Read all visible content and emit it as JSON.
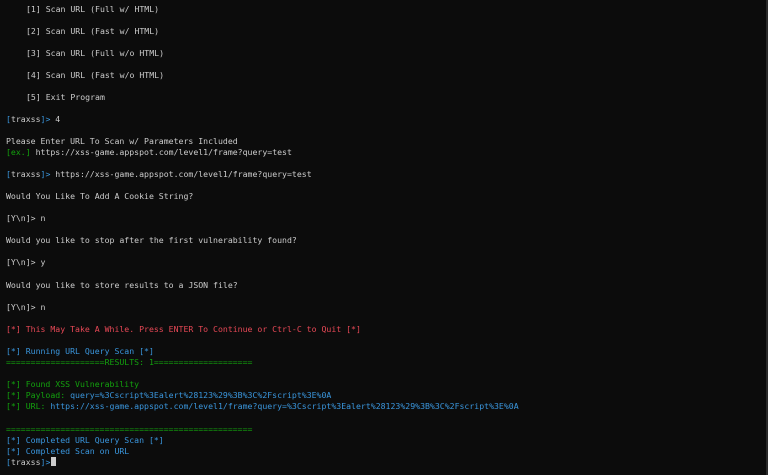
{
  "menu": {
    "opt1": "[1] Scan URL (Full w/ HTML)",
    "opt2": "[2] Scan URL (Fast w/ HTML)",
    "opt3": "[3] Scan URL (Full w/o HTML)",
    "opt4": "[4] Scan URL (Fast w/o HTML)",
    "opt5": "[5] Exit Program"
  },
  "prompt": {
    "open": "[",
    "name": "traxss",
    "close": "]>",
    "yn": "[Y\\n]>"
  },
  "session": {
    "choice": " 4",
    "enter_url": "Please Enter URL To Scan w/ Parameters Included",
    "example_tag": "[ex.]",
    "example_url": " https://xss-game.appspot.com/level1/frame?query=test",
    "url_input": " https://xss-game.appspot.com/level1/frame?query=test",
    "cookie_q": "Would You Like To Add A Cookie String?",
    "cookie_a": " n",
    "stop_q": "Would you like to stop after the first vulnerability found?",
    "stop_a": " y",
    "json_q": "Would you like to store results to a JSON file?",
    "json_a": " n",
    "warning": "[*] This May Take A While. Press ENTER To Continue or Ctrl-C to Quit [*]",
    "running": "[*] Running URL Query Scan [*]",
    "results_bar": "====================RESULTS: 1====================",
    "found": "[*] Found XSS Vulnerability",
    "payload_tag": "[*] Payload:",
    "payload": " query=%3Cscript%3Ealert%28123%29%3B%3C%2Fscript%3E%0A",
    "url_tag": "[*] URL:",
    "url": " https://xss-game.appspot.com/level1/frame?query=%3Cscript%3Ealert%28123%29%3B%3C%2Fscript%3E%0A",
    "end_bar": "==================================================",
    "completed_query": "[*] Completed URL Query Scan [*]",
    "completed_scan": "[*] Completed Scan on URL"
  },
  "colors": {
    "background": "#0c0c0c",
    "text": "#cccccc",
    "blue": "#3a96dd",
    "green": "#13a10e",
    "red": "#e74856"
  }
}
